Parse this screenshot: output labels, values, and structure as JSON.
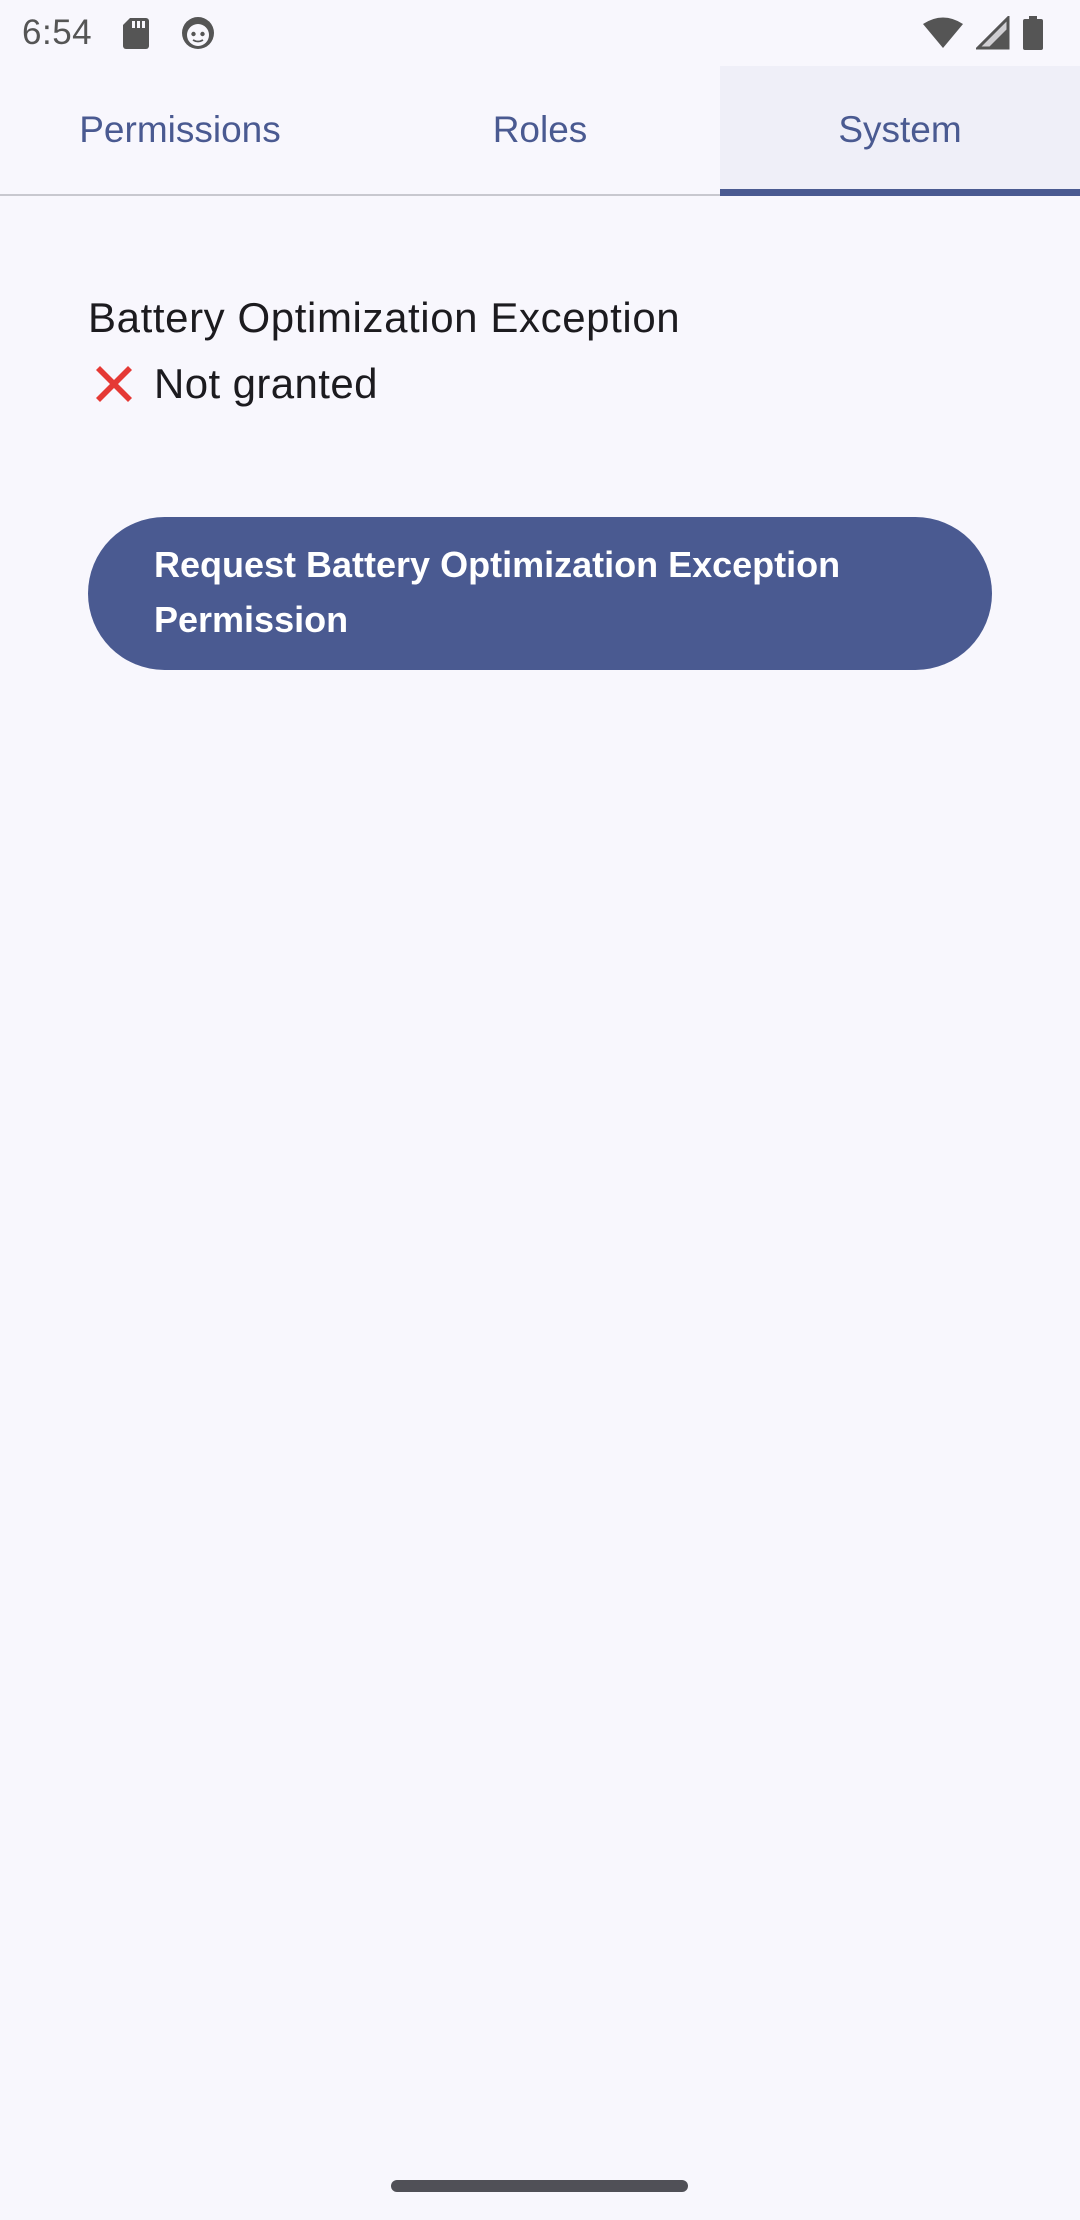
{
  "status_bar": {
    "time": "6:54",
    "icons": [
      "sd-card-icon",
      "face-icon",
      "wifi-icon",
      "signal-icon",
      "battery-icon"
    ]
  },
  "tabs": [
    {
      "label": "Permissions",
      "selected": false
    },
    {
      "label": "Roles",
      "selected": false
    },
    {
      "label": "System",
      "selected": true
    }
  ],
  "permission": {
    "title": "Battery Optimization Exception",
    "status_icon": "cross-mark-icon",
    "status_text": "Not granted"
  },
  "request_button": {
    "label": "Request Battery Optimization Exception Permission"
  },
  "colors": {
    "accent": "#4a5a91",
    "background": "#f8f7fd",
    "status_red": "#e53935"
  }
}
